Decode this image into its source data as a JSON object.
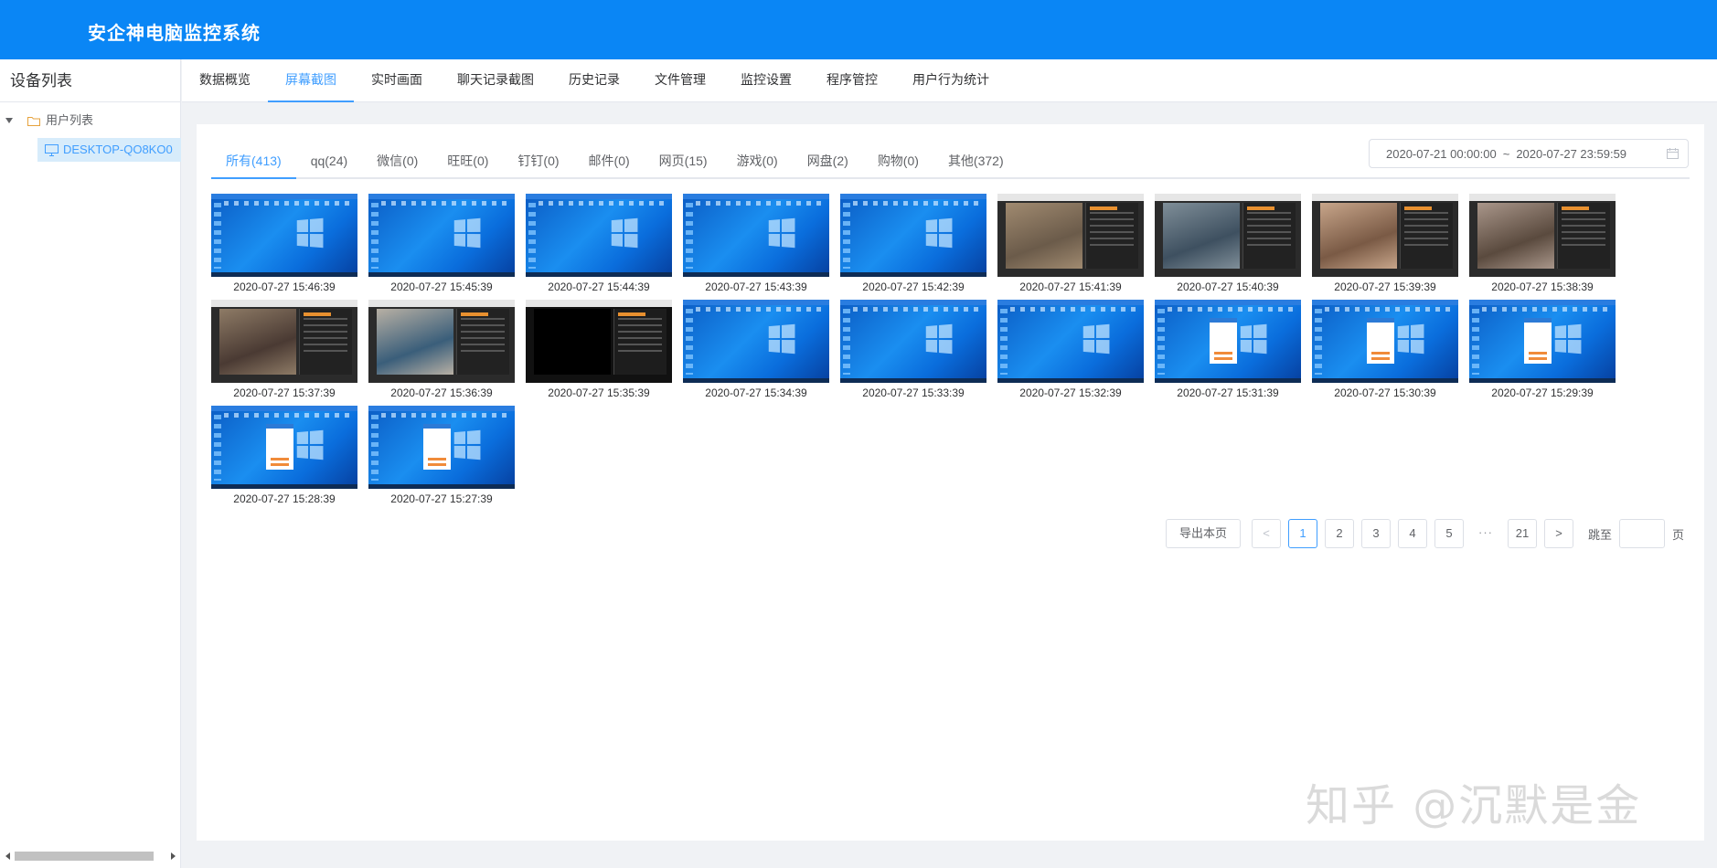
{
  "app": {
    "title": "安企神电脑监控系统"
  },
  "sidebar": {
    "title": "设备列表",
    "tree": {
      "root_label": "用户列表",
      "device_label": "DESKTOP-QO8KO0"
    }
  },
  "topnav": {
    "items": [
      "数据概览",
      "屏幕截图",
      "实时画面",
      "聊天记录截图",
      "历史记录",
      "文件管理",
      "监控设置",
      "程序管控",
      "用户行为统计"
    ],
    "active": "屏幕截图"
  },
  "subtabs": {
    "items": [
      "所有(413)",
      "qq(24)",
      "微信(0)",
      "旺旺(0)",
      "钉钉(0)",
      "邮件(0)",
      "网页(15)",
      "游戏(0)",
      "网盘(2)",
      "购物(0)",
      "其他(372)"
    ],
    "active": "所有(413)"
  },
  "daterange": {
    "start": "2020-07-21 00:00:00",
    "separator": "~",
    "end": "2020-07-27 23:59:59"
  },
  "screenshots": [
    {
      "time": "2020-07-27 15:46:39",
      "kind": "desktop"
    },
    {
      "time": "2020-07-27 15:45:39",
      "kind": "desktop"
    },
    {
      "time": "2020-07-27 15:44:39",
      "kind": "desktop"
    },
    {
      "time": "2020-07-27 15:43:39",
      "kind": "desktop"
    },
    {
      "time": "2020-07-27 15:42:39",
      "kind": "desktop"
    },
    {
      "time": "2020-07-27 15:41:39",
      "kind": "video"
    },
    {
      "time": "2020-07-27 15:40:39",
      "kind": "video"
    },
    {
      "time": "2020-07-27 15:39:39",
      "kind": "video"
    },
    {
      "time": "2020-07-27 15:38:39",
      "kind": "video"
    },
    {
      "time": "2020-07-27 15:37:39",
      "kind": "video"
    },
    {
      "time": "2020-07-27 15:36:39",
      "kind": "video"
    },
    {
      "time": "2020-07-27 15:35:39",
      "kind": "black"
    },
    {
      "time": "2020-07-27 15:34:39",
      "kind": "desktop"
    },
    {
      "time": "2020-07-27 15:33:39",
      "kind": "desktop"
    },
    {
      "time": "2020-07-27 15:32:39",
      "kind": "desktop"
    },
    {
      "time": "2020-07-27 15:31:39",
      "kind": "dialog"
    },
    {
      "time": "2020-07-27 15:30:39",
      "kind": "dialog"
    },
    {
      "time": "2020-07-27 15:29:39",
      "kind": "dialog"
    },
    {
      "time": "2020-07-27 15:28:39",
      "kind": "dialog"
    },
    {
      "time": "2020-07-27 15:27:39",
      "kind": "dialog"
    }
  ],
  "pagination": {
    "export_label": "导出本页",
    "prev": "<",
    "pages": [
      "1",
      "2",
      "3",
      "4",
      "5"
    ],
    "active_page": "1",
    "more": "···",
    "last_page": "21",
    "next": ">",
    "jump_label": "跳至",
    "jump_value": "",
    "unit": "页"
  },
  "watermark": "知乎 @沉默是金",
  "colors": {
    "header": "#0a86f5",
    "accent": "#409eff"
  }
}
